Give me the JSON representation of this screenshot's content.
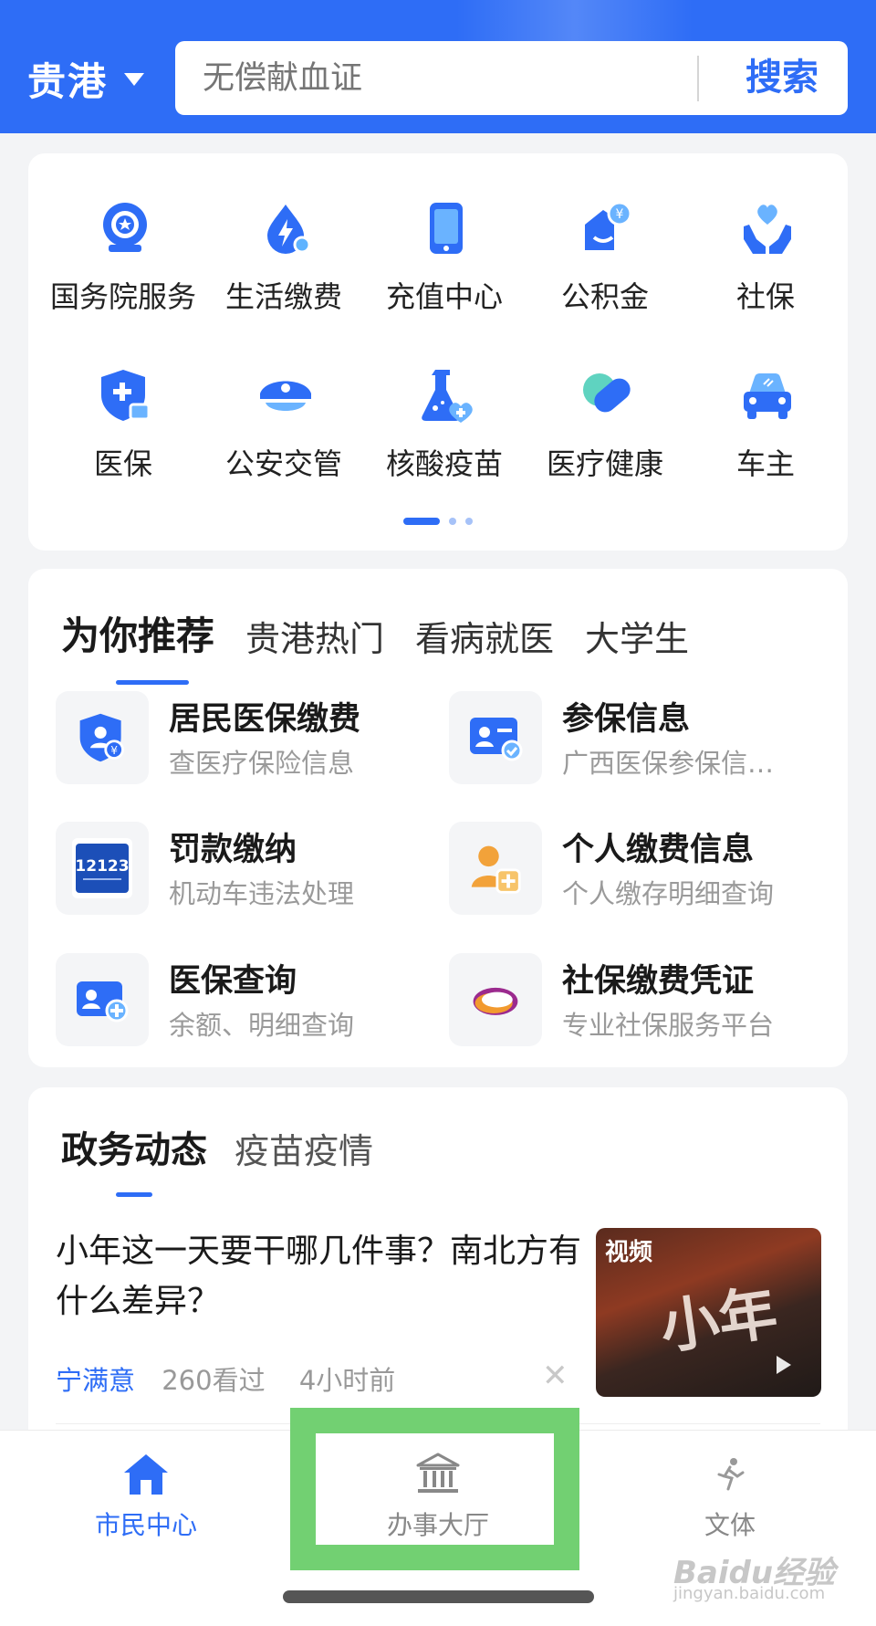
{
  "header": {
    "city": "贵港",
    "search_placeholder": "无偿献血证",
    "search_button": "搜索"
  },
  "services_grid": [
    {
      "label": "国务院服务",
      "icon": "state-council-icon"
    },
    {
      "label": "生活缴费",
      "icon": "utility-bill-icon"
    },
    {
      "label": "充值中心",
      "icon": "phone-recharge-icon"
    },
    {
      "label": "公积金",
      "icon": "housing-fund-icon"
    },
    {
      "label": "社保",
      "icon": "social-security-icon"
    },
    {
      "label": "医保",
      "icon": "medical-insurance-icon"
    },
    {
      "label": "公安交管",
      "icon": "police-cap-icon"
    },
    {
      "label": "核酸疫苗",
      "icon": "flask-icon"
    },
    {
      "label": "医疗健康",
      "icon": "pill-icon"
    },
    {
      "label": "车主",
      "icon": "car-icon"
    }
  ],
  "recommend": {
    "tabs": [
      "为你推荐",
      "贵港热门",
      "看病就医",
      "大学生"
    ],
    "items": [
      {
        "title": "居民医保缴费",
        "subtitle": "查医疗保险信息",
        "icon": "shield-user-icon"
      },
      {
        "title": "参保信息",
        "subtitle": "广西医保参保信…",
        "icon": "id-card-icon"
      },
      {
        "title": "罚款缴纳",
        "subtitle": "机动车违法处理",
        "icon": "12123-icon",
        "icon_text": "12123"
      },
      {
        "title": "个人缴费信息",
        "subtitle": "个人缴存明细查询",
        "icon": "user-plus-icon"
      },
      {
        "title": "医保查询",
        "subtitle": "余额、明细查询",
        "icon": "user-card-icon"
      },
      {
        "title": "社保缴费凭证",
        "subtitle": "专业社保服务平台",
        "icon": "cloud-logo-icon"
      }
    ]
  },
  "news": {
    "tabs": [
      "政务动态",
      "疫苗疫情"
    ],
    "item": {
      "title": "小年这一天要干哪几件事？南北方有什么差异？",
      "source": "宁满意",
      "views": "260看过",
      "time": "4小时前",
      "thumb_tag": "视频",
      "thumb_text": "小年"
    }
  },
  "tabbar": [
    {
      "label": "市民中心",
      "icon": "home-icon",
      "active": true
    },
    {
      "label": "办事大厅",
      "icon": "bank-building-icon",
      "active": false
    },
    {
      "label": "文体",
      "icon": "runner-icon",
      "active": false
    }
  ],
  "watermark": {
    "main": "Baidu经验",
    "sub": "jingyan.baidu.com"
  },
  "colors": {
    "primary": "#2e6df6",
    "highlight": "#72d072"
  }
}
